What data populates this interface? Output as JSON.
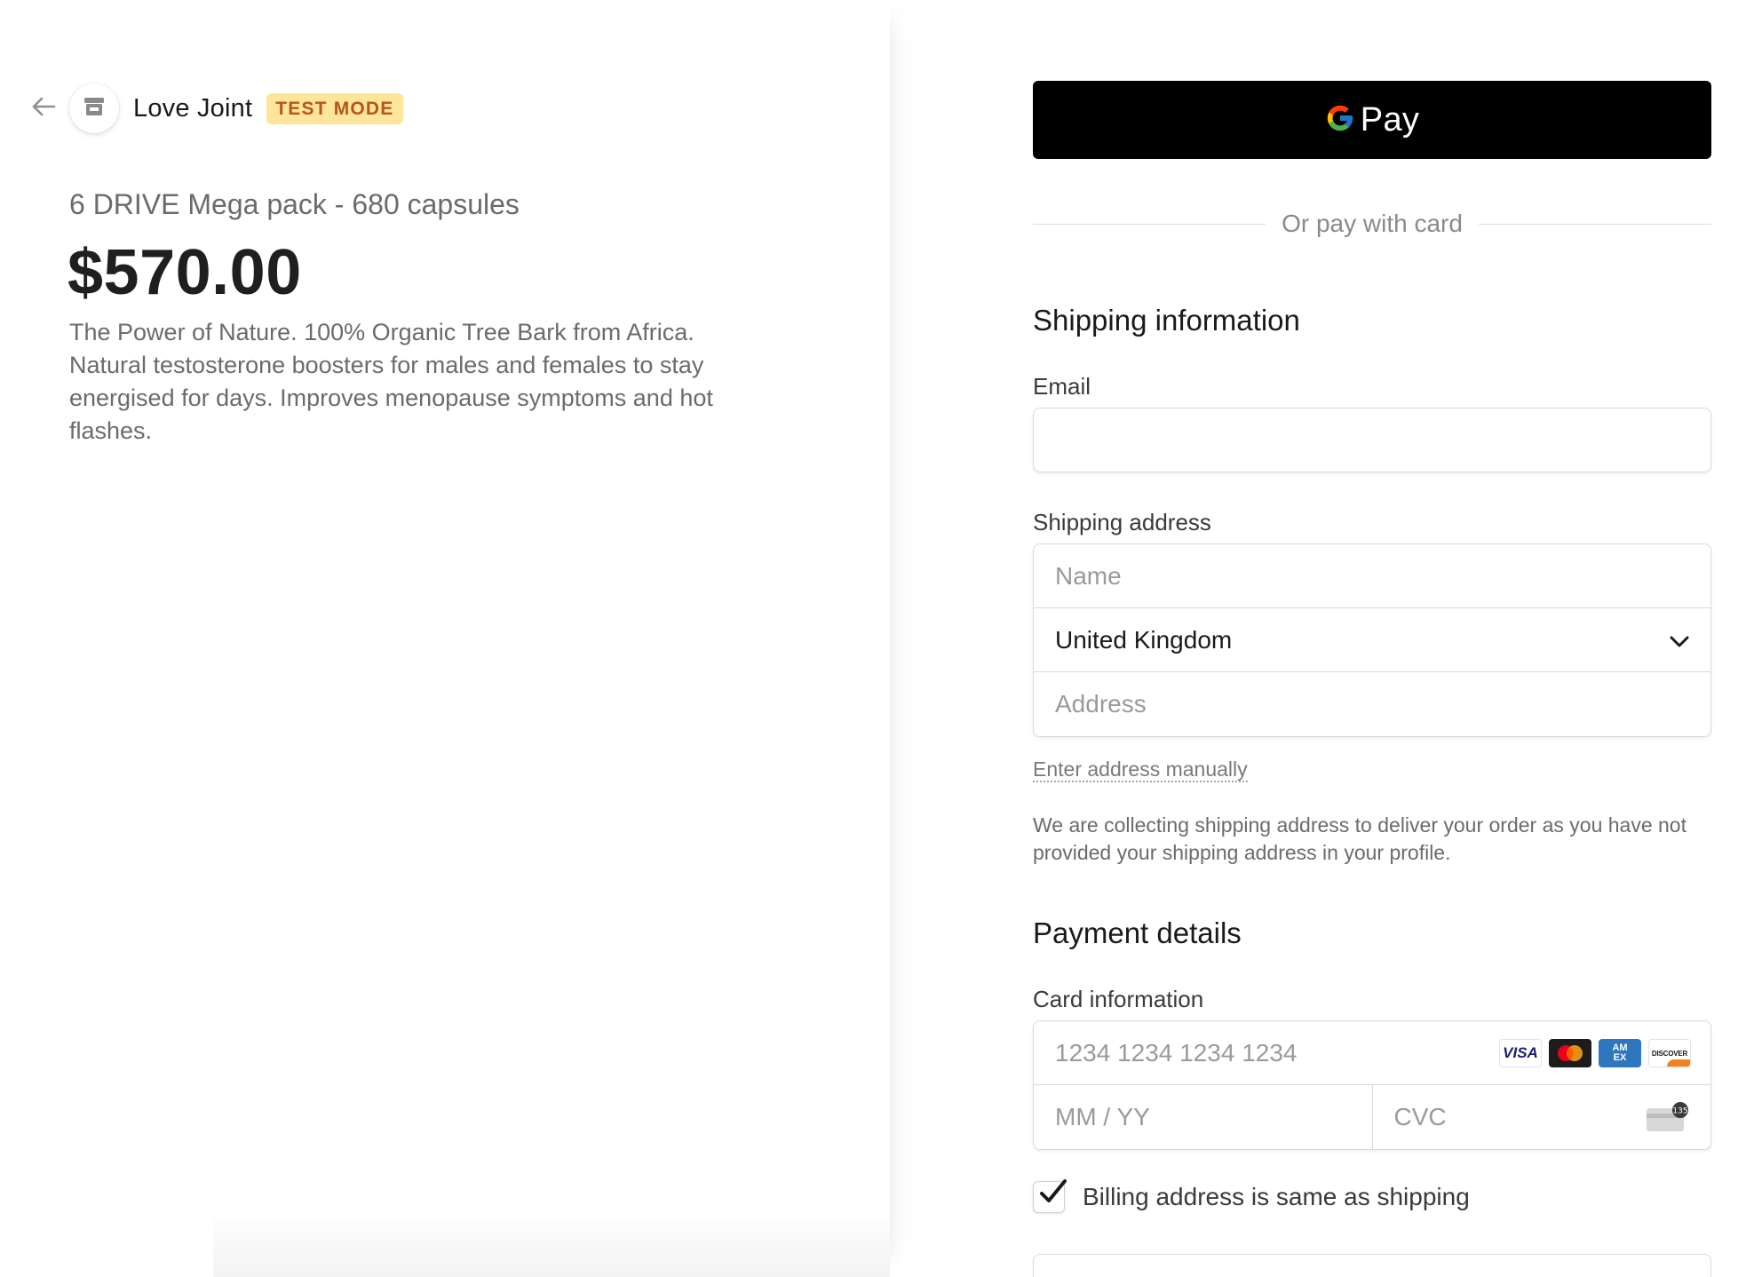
{
  "header": {
    "store_name": "Love Joint",
    "test_badge": "TEST MODE"
  },
  "product": {
    "name": "6 DRIVE Mega pack - 680 capsules",
    "price": "$570.00",
    "description": "The Power of Nature. 100% Organic Tree Bark from Africa. Natural testosterone boosters for males and females to stay energised for days. Improves menopause symptoms and hot flashes."
  },
  "gpay": {
    "label": "Pay"
  },
  "divider": {
    "text": "Or pay with card"
  },
  "shipping": {
    "title": "Shipping information",
    "email_label": "Email",
    "email_value": "",
    "address_label": "Shipping address",
    "name_placeholder": "Name",
    "country_value": "United Kingdom",
    "address_placeholder": "Address",
    "manual_link": "Enter address manually",
    "helper_text": "We are collecting shipping address to deliver your order as you have not provided your shipping address in your profile."
  },
  "payment": {
    "title": "Payment details",
    "card_label": "Card information",
    "card_number_placeholder": "1234 1234 1234 1234",
    "expiry_placeholder": "MM / YY",
    "cvc_placeholder": "CVC",
    "cvc_hint": "135",
    "brands": [
      {
        "name": "visa",
        "text": "VISA"
      },
      {
        "name": "mastercard",
        "text": ""
      },
      {
        "name": "amex",
        "text": "AM EX"
      },
      {
        "name": "discover",
        "text": "DISCOVER"
      }
    ],
    "billing_same_label": "Billing address is same as shipping",
    "billing_same_checked": true
  },
  "colors": {
    "badge_bg": "#fde59a",
    "badge_text": "#b5561b",
    "gpay_bg": "#000000",
    "visa": "#1a1f71",
    "amex": "#2e77bc",
    "discover_orange": "#f48120"
  }
}
